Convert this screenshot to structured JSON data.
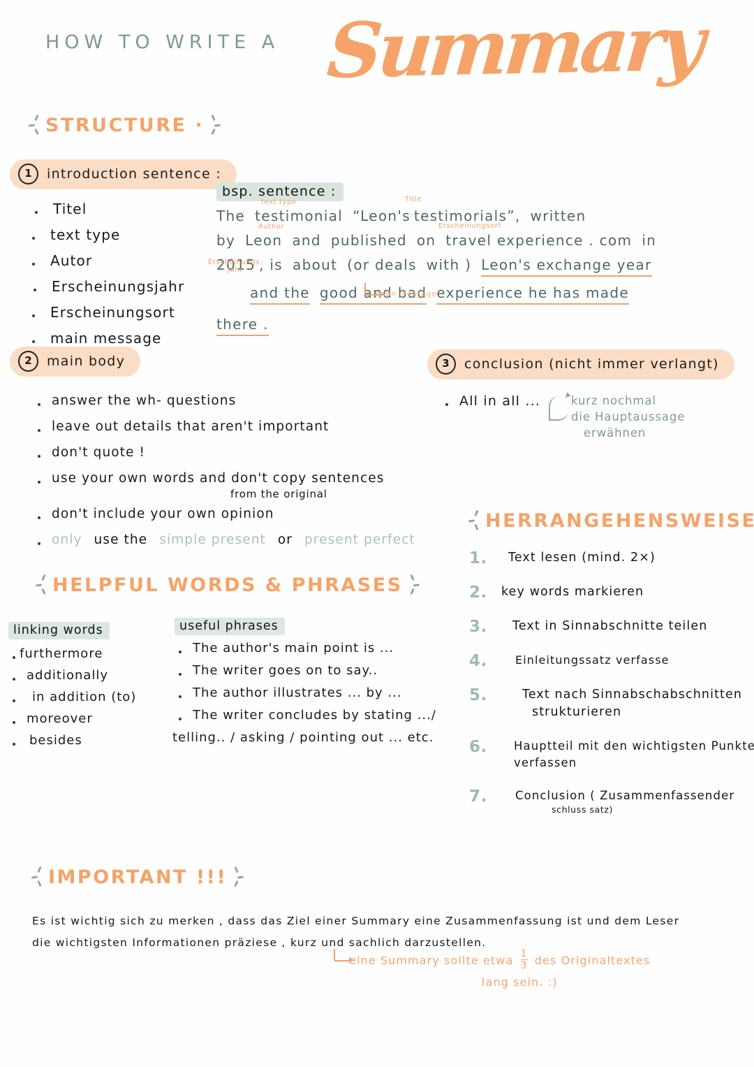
{
  "title": {
    "prefix": "HOW TO WRITE A",
    "script": "Summary"
  },
  "colors": {
    "orange": "#f5a368",
    "sage_green": "#7d9b8c",
    "peach_pill": "#fbdcc5",
    "green_highlight": "#d8e5dd",
    "ink": "#1a1a1a"
  },
  "sections": {
    "structure": {
      "heading": "STRUCTURE ·"
    },
    "helpful": {
      "heading": "HELPFUL WORDS & PHRASES"
    },
    "approach": {
      "heading": "HERRANGEHENSWEISE"
    },
    "important": {
      "heading": "IMPORTANT !!!"
    }
  },
  "step1": {
    "badge_number": "1",
    "label": "introduction sentence :",
    "fields": [
      "Titel",
      "text type",
      "Autor",
      "Erscheinungsjahr",
      "Erscheinungsort",
      "main message"
    ]
  },
  "example": {
    "heading": "bsp. sentence :",
    "line1": {
      "w1": "The",
      "w2": "testimonial",
      "w3": "“Leon's",
      "w4": "testimorials”,",
      "w5": "written"
    },
    "line2": {
      "w1": "by",
      "w2": "Leon",
      "w3": "and",
      "w4": "published",
      "w5": "on",
      "w6": "travel experience . com",
      "w7": "in"
    },
    "line3": {
      "w1": "2015",
      "w2": ", is",
      "w3": "about",
      "w4": "(or deals",
      "w5": "with )",
      "w6": "Leon's    exchange    year"
    },
    "line4": {
      "w1": "and    the",
      "w2": "good and    bad",
      "w3": "experience    he    has    made"
    },
    "line5": {
      "w1": "there ."
    },
    "annotations": {
      "text_type": "text type",
      "title": "Title",
      "author": "Author",
      "erscheinungsort": "Erscheinungsort",
      "erscheinungsjahr_l1": "Erscheinungs-",
      "erscheinungsjahr_l2": "jahr",
      "main_message": "main message"
    }
  },
  "step2": {
    "badge_number": "2",
    "label": "main body",
    "bullets": [
      "answer   the   wh- questions",
      "leave  out  details  that   aren't  important",
      "don't  quote !",
      "use   your  own   words  and  don't  copy   sentences",
      "don't   include   your   own   opinion"
    ],
    "subnote": "from   the    original",
    "last_bullet": {
      "only": "only",
      "use_the": "use  the",
      "simple_present": "simple   present",
      "or": "or",
      "present_perfect": "present perfect"
    }
  },
  "step3": {
    "badge_number": "3",
    "label": "conclusion (nicht immer  verlangt)",
    "bullets": [
      "All  in  all ..."
    ],
    "note_line1": "kurz   nochmal",
    "note_line2": "die Hauptaussage",
    "note_line3": "erwähnen"
  },
  "helpful": {
    "linking": {
      "heading": "linking words",
      "items": [
        "furthermore",
        "additionally",
        "in  addition (to)",
        "moreover",
        "besides"
      ]
    },
    "phrases": {
      "heading": "useful   phrases",
      "items": [
        "The    author's main   point   is ...",
        "The   writer   goes  on to   say..",
        "The   author   illustrates ...  by ...",
        "The   writer   concludes   by   stating .../"
      ],
      "tail": "telling.. / asking / pointing   out  ...   etc."
    }
  },
  "approach": {
    "steps": [
      {
        "n": "1.",
        "text": "Text  lesen   (mind.   2×)",
        "sub": ""
      },
      {
        "n": "2.",
        "text": "key  words    markieren",
        "sub": ""
      },
      {
        "n": "3.",
        "text": "Text   in   Sinnabschnitte    teilen",
        "sub": ""
      },
      {
        "n": "4.",
        "text": "Einleitungssatz   verfasse",
        "sub": ""
      },
      {
        "n": "5.",
        "text": "Text      nach   Sinnabschabschnitten",
        "sub2": "strukturieren"
      },
      {
        "n": "6.",
        "text": "Hauptteil  mit  den  wichtigsten  Punkten",
        "sub2": "verfassen"
      },
      {
        "n": "7.",
        "text": "Conclusion  ( Zusammenfassender",
        "sub": "schluss satz)"
      }
    ]
  },
  "important": {
    "line1": "Es  ist  wichtig  sich  zu  merken , dass   das   Ziel  einer  Summary  eine  Zusammenfassung  ist  und   dem  Leser",
    "line2": "die   wichtigsten  Informationen    präziese , kurz  und   sachlich   darzustellen.",
    "note_line1a": "eine   Summary   sollte   etwa",
    "fraction_num": "1",
    "fraction_den": "3",
    "note_line1b": "des  Originaltextes",
    "note_line2": "lang    sein. :)"
  }
}
